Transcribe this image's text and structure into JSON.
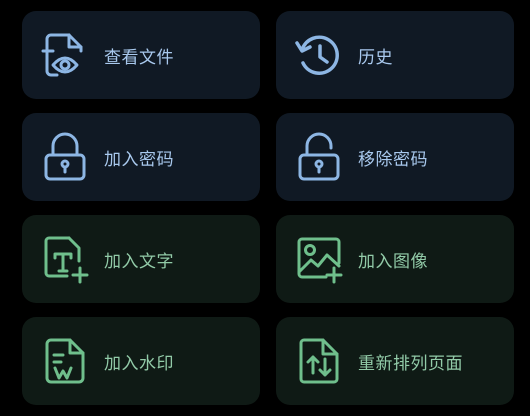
{
  "colors": {
    "background": "#000000",
    "blue_card": "#101924",
    "green_card": "#0f1a15",
    "blue_accent": "#8db6e4",
    "green_accent": "#6fbf8c"
  },
  "tiles": [
    {
      "label": "查看文件",
      "icon": "view-file-eye-icon"
    },
    {
      "label": "历史",
      "icon": "history-clock-icon"
    },
    {
      "label": "加入密码",
      "icon": "lock-closed-icon"
    },
    {
      "label": "移除密码",
      "icon": "lock-open-icon"
    },
    {
      "label": "加入文字",
      "icon": "add-text-icon"
    },
    {
      "label": "加入图像",
      "icon": "add-image-icon"
    },
    {
      "label": "加入水印",
      "icon": "add-watermark-icon"
    },
    {
      "label": "重新排列页面",
      "icon": "reorder-pages-icon"
    }
  ]
}
